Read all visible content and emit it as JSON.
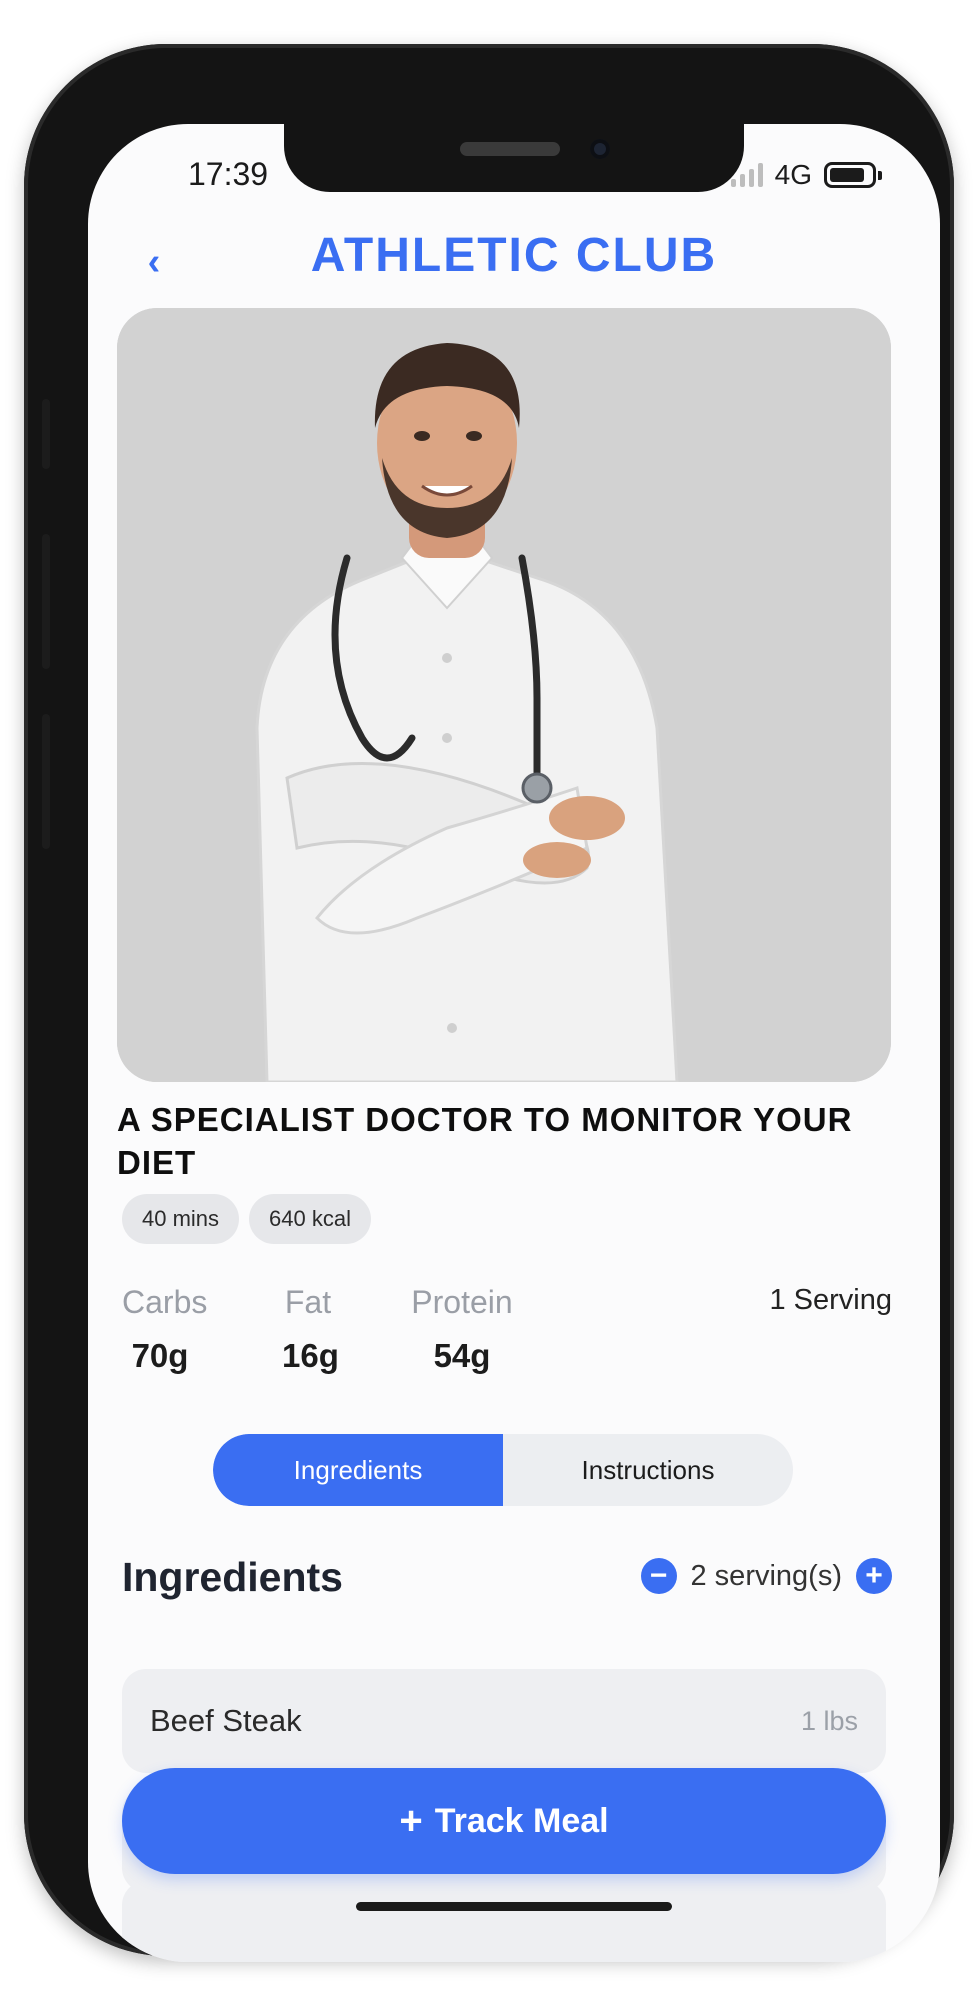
{
  "status_bar": {
    "time": "17:39",
    "network": "4G",
    "battery_level": 0.85
  },
  "header": {
    "back_icon": "chevron-left-icon",
    "title": "ATHLETIC CLUB"
  },
  "hero": {
    "image_subject": "doctor-portrait"
  },
  "article": {
    "title": "A SPECIALIST DOCTOR TO MONITOR YOUR DIET",
    "tags": [
      "40 mins",
      "640 kcal"
    ]
  },
  "macros": [
    {
      "label": "Carbs",
      "value": "70g"
    },
    {
      "label": "Fat",
      "value": "16g"
    },
    {
      "label": "Protein",
      "value": "54g"
    }
  ],
  "serving": "1 Serving",
  "tabs": [
    {
      "label": "Ingredients",
      "active": true
    },
    {
      "label": "Instructions",
      "active": false
    }
  ],
  "ingredients": {
    "title": "Ingredients",
    "servings": "2 serving(s)",
    "items": [
      {
        "name": "Beef Steak",
        "qty": "1 lbs"
      }
    ]
  },
  "track_button": {
    "label": "Track Meal"
  },
  "colors": {
    "accent": "#3a6ef2",
    "background": "#fbfbfc",
    "hero_bg": "#d2d2d2"
  }
}
